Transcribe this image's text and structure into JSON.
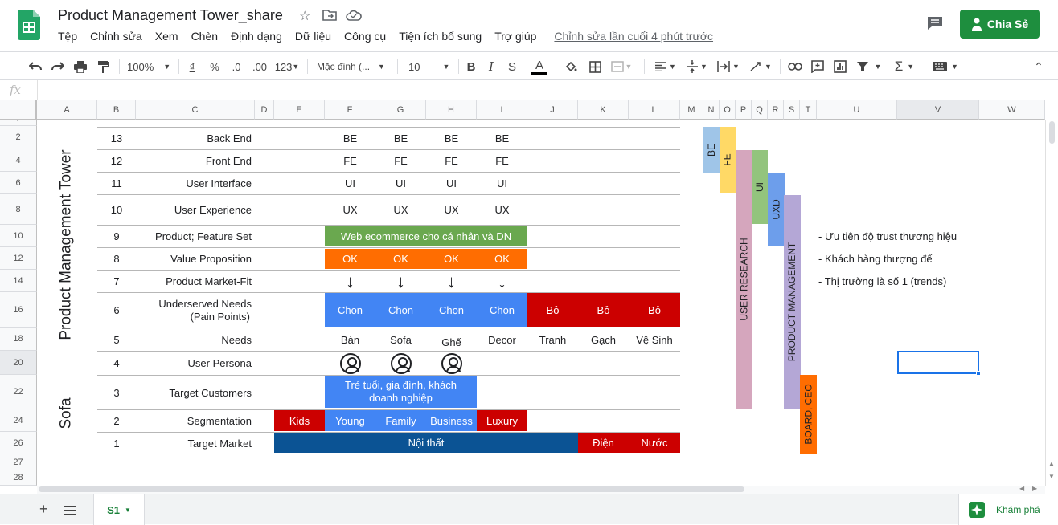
{
  "app": {
    "title": "Product Management Tower_share",
    "menu": [
      "Tệp",
      "Chỉnh sửa",
      "Xem",
      "Chèn",
      "Định dạng",
      "Dữ liệu",
      "Công cụ",
      "Tiện ích bổ sung",
      "Trợ giúp"
    ],
    "last_edit": "Chỉnh sửa lần cuối 4 phút trước",
    "share_label": "Chia Sẻ"
  },
  "toolbar": {
    "zoom": "100%",
    "currency": "₫",
    "percent": "%",
    "dec_less": ".0",
    "dec_more": ".00",
    "format_more": "123",
    "font": "Mặc định (...",
    "font_size": "10",
    "bold": "B",
    "italic": "I",
    "text_color": "A"
  },
  "formula_bar": {
    "fx": "fx",
    "value": ""
  },
  "columns": [
    "A",
    "B",
    "C",
    "D",
    "E",
    "F",
    "G",
    "H",
    "I",
    "J",
    "K",
    "L",
    "M",
    "N",
    "O",
    "P",
    "Q",
    "R",
    "S",
    "T",
    "U",
    "V",
    "W"
  ],
  "row_numbers": [
    "1",
    "2",
    "4",
    "6",
    "8",
    "10",
    "12",
    "14",
    "16",
    "18",
    "20",
    "22",
    "24",
    "26",
    "27",
    "28"
  ],
  "tower": {
    "title": "Product Management Tower",
    "sofa": "Sofa",
    "levels": [
      {
        "num": "13",
        "label": "Back End",
        "items": [
          "BE",
          "BE",
          "BE",
          "BE"
        ]
      },
      {
        "num": "12",
        "label": "Front End",
        "items": [
          "FE",
          "FE",
          "FE",
          "FE"
        ]
      },
      {
        "num": "11",
        "label": "User Interface",
        "items": [
          "UI",
          "UI",
          "UI",
          "UI"
        ]
      },
      {
        "num": "10",
        "label": "User Experience",
        "items": [
          "UX",
          "UX",
          "UX",
          "UX"
        ]
      },
      {
        "num": "9",
        "label": "Product; Feature Set",
        "banner": "Web ecommerce cho cá nhân và DN"
      },
      {
        "num": "8",
        "label": "Value Proposition",
        "items": [
          "OK",
          "OK",
          "OK",
          "OK"
        ]
      },
      {
        "num": "7",
        "label": "Product Market-Fit",
        "arrows": [
          "↓",
          "↓",
          "↓",
          "↓"
        ]
      },
      {
        "num": "6",
        "label_line1": "Underserved Needs",
        "label_line2": "(Pain Points)",
        "chosen": [
          "Chọn",
          "Chọn",
          "Chọn",
          "Chọn"
        ],
        "dropped": [
          "Bỏ",
          "Bỏ",
          "Bỏ"
        ]
      },
      {
        "num": "5",
        "label": "Needs",
        "items": [
          "Bàn",
          "Sofa",
          "Ghế",
          "Decor",
          "Tranh",
          "Gạch",
          "Vệ Sinh"
        ]
      },
      {
        "num": "4",
        "label": "User Persona"
      },
      {
        "num": "3",
        "label": "Target Customers",
        "banner": "Trẻ tuổi, gia đình, khách doanh nghiệp"
      },
      {
        "num": "2",
        "label": "Segmentation",
        "segments": [
          "Kids",
          "Young",
          "Family",
          "Business",
          "Luxury"
        ]
      },
      {
        "num": "1",
        "label": "Target Market",
        "markets": [
          "Nội thất",
          "Điện",
          "Nước"
        ]
      }
    ]
  },
  "side_bars": [
    "BE",
    "FE",
    "USER RESEARCH",
    "UI",
    "UXD",
    "PRODUCT MANAGEMENT",
    "BOARD, CEO"
  ],
  "notes": [
    "- Ưu tiên độ trust thương hiệu",
    "- Khách hàng thượng đế",
    "- Thị trường là số 1 (trends)"
  ],
  "sheets": {
    "tab": "S1",
    "explore": "Khám phá"
  },
  "colors": {
    "green": "#6aa84f",
    "orange": "#ff6d01",
    "blue": "#4285f4",
    "red": "#cc0000",
    "navy": "#0b5394",
    "share": "#1e8e3e"
  }
}
